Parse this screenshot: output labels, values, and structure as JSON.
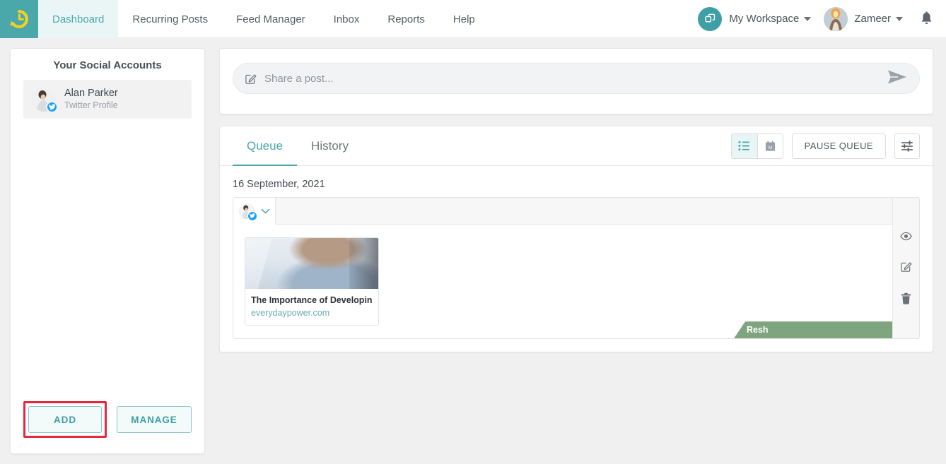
{
  "header": {
    "logo_icon": "clock-refresh-logo-icon",
    "nav": [
      {
        "label": "Dashboard",
        "active": true
      },
      {
        "label": "Recurring Posts",
        "active": false
      },
      {
        "label": "Feed Manager",
        "active": false
      },
      {
        "label": "Inbox",
        "active": false
      },
      {
        "label": "Reports",
        "active": false
      },
      {
        "label": "Help",
        "active": false
      }
    ],
    "workspace_label": "My Workspace",
    "workspace_icon": "workspace-squares-icon",
    "user_label": "Zameer",
    "user_avatar": "user-avatar",
    "bell_icon": "notification-bell-icon"
  },
  "sidebar": {
    "title": "Your Social Accounts",
    "accounts": [
      {
        "name": "Alan Parker",
        "type": "Twitter Profile",
        "badge_icon": "twitter-icon",
        "avatar": "account-avatar"
      }
    ],
    "add_label": "ADD",
    "manage_label": "MANAGE",
    "add_highlight_color": "#e8273f"
  },
  "share": {
    "icon": "compose-pencil-icon",
    "placeholder": "Share a post...",
    "send_icon": "send-arrow-icon"
  },
  "queue": {
    "tabs": [
      {
        "label": "Queue",
        "active": true
      },
      {
        "label": "History",
        "active": false
      }
    ],
    "view_list_icon": "list-view-icon",
    "view_calendar_icon": "calendar-view-icon",
    "pause_label": "PAUSE QUEUE",
    "filter_icon": "filter-sliders-icon",
    "date_label": "16 September, 2021",
    "post": {
      "account_avatar": "post-account-avatar",
      "account_badge_icon": "twitter-icon",
      "account_caret_icon": "chevron-down-icon",
      "link_title": "The Importance of Developin...",
      "link_domain": "everydaypower.com",
      "link_thumb": "article-thumbnail-man-writing",
      "ribbon_label": "Resh",
      "ribbon_color": "#7fa57f",
      "actions": [
        {
          "icon": "eye-preview-icon"
        },
        {
          "icon": "edit-pencil-icon"
        },
        {
          "icon": "trash-delete-icon"
        }
      ]
    }
  },
  "colors": {
    "accent_teal": "#4aa8ab",
    "logo_bg": "#4aa8ab",
    "logo_mark": "#f2d024",
    "twitter_blue": "#1da1f2",
    "highlight_red": "#e8273f",
    "ribbon_green": "#7fa57f"
  }
}
